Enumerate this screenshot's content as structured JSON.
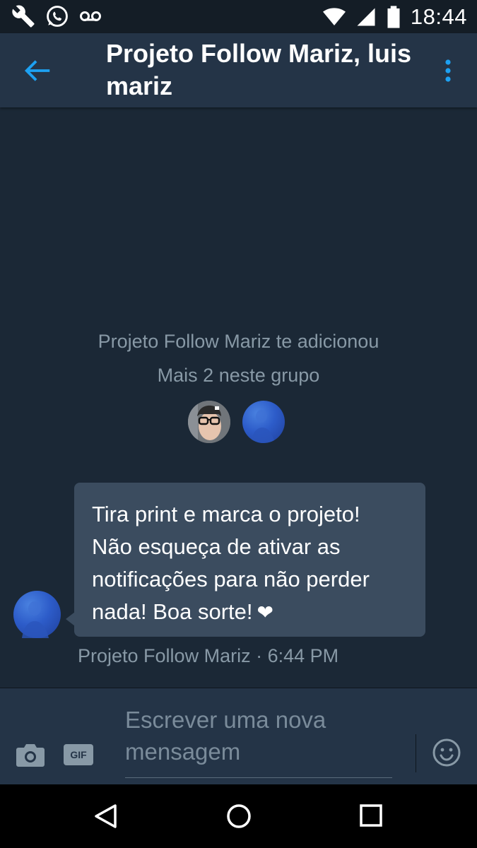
{
  "status_bar": {
    "time": "18:44",
    "left_icons": [
      "wrench-icon",
      "whatsapp-icon",
      "voicemail-icon"
    ],
    "right_icons": [
      "wifi-icon",
      "signal-icon",
      "battery-icon"
    ]
  },
  "header": {
    "title": "Projeto Follow Mariz, luis mariz",
    "accent_color": "#1da1f2"
  },
  "conversation": {
    "system_line1": "Projeto Follow Mariz te adicionou",
    "system_line2": "Mais 2 neste grupo",
    "message": {
      "lines": [
        "Tira print e marca o projeto!",
        "Não esqueça de ativar as",
        "notificações para não perder",
        "nada! Boa sorte!"
      ],
      "heart": "❤",
      "meta": "Projeto Follow Mariz · 6:44 PM"
    }
  },
  "composer": {
    "placeholder": "Escrever uma nova mensagem",
    "gif_label": "GIF"
  },
  "colors": {
    "background": "#1b2836",
    "header": "#243447",
    "bubble": "#3b4c5f",
    "secondary_text": "#8899a6"
  }
}
